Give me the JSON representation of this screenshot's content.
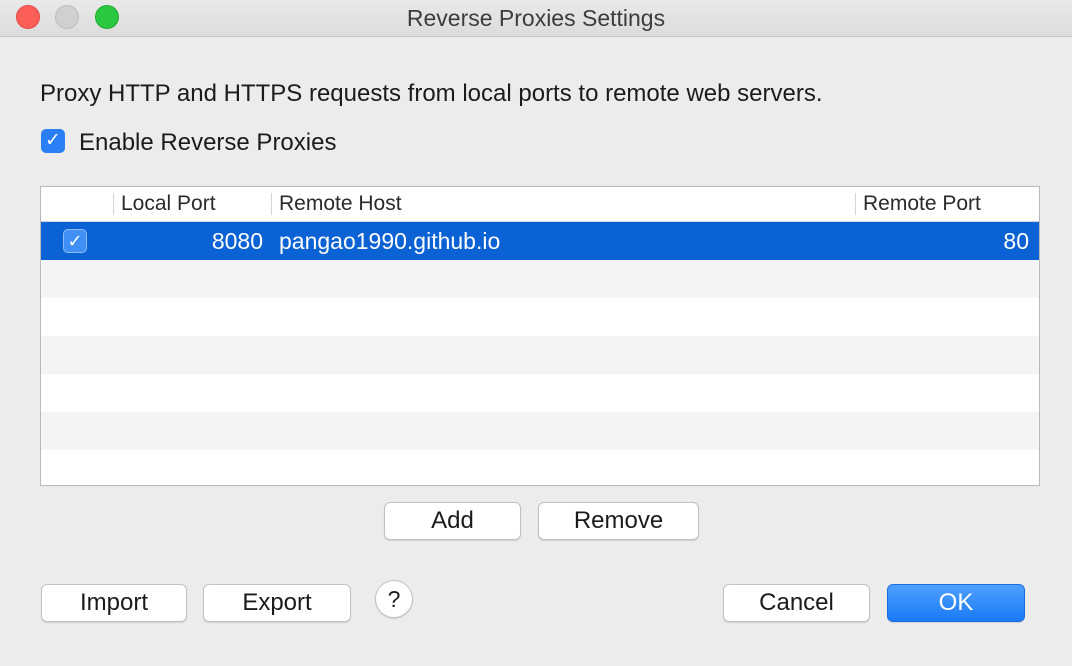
{
  "window": {
    "title": "Reverse Proxies Settings"
  },
  "description": "Proxy HTTP and HTTPS requests from local ports to remote web servers.",
  "enable": {
    "label": "Enable Reverse Proxies",
    "checked": true,
    "check_glyph": "✓"
  },
  "table": {
    "columns": [
      "",
      "Local Port",
      "Remote Host",
      "Remote Port"
    ],
    "rows": [
      {
        "enabled": true,
        "check_glyph": "✓",
        "local_port": "8080",
        "remote_host": "pangao1990.github.io",
        "remote_port": "80",
        "selected": true
      }
    ]
  },
  "buttons": {
    "add": "Add",
    "remove": "Remove",
    "import": "Import",
    "export": "Export",
    "help": "?",
    "cancel": "Cancel",
    "ok": "OK"
  },
  "colors": {
    "selection": "#0b62d4",
    "accent": "#2b7ff5",
    "close": "#fc5f57",
    "zoom": "#2ac840"
  }
}
